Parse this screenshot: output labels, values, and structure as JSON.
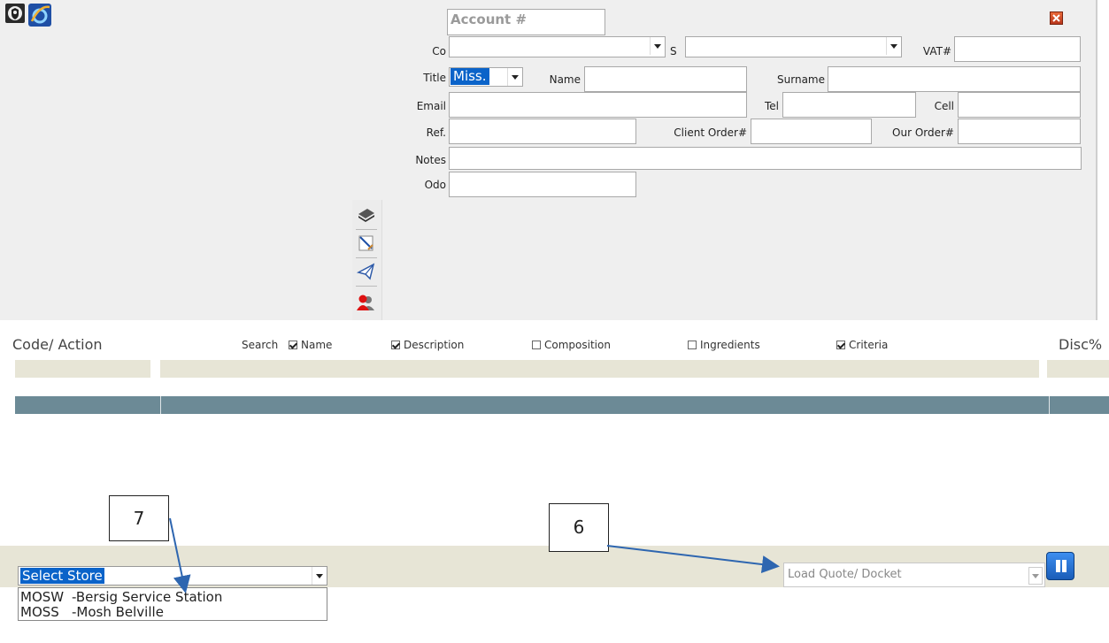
{
  "account": {
    "placeholder": "Account #"
  },
  "form": {
    "co_label": "Co",
    "s_label": "S",
    "vat_label": "VAT#",
    "title_label": "Title",
    "title_value": "Miss.",
    "name_label": "Name",
    "surname_label": "Surname",
    "email_label": "Email",
    "tel_label": "Tel",
    "cell_label": "Cell",
    "ref_label": "Ref.",
    "client_order_label": "Client Order#",
    "our_order_label": "Our Order#",
    "notes_label": "Notes",
    "odo_label": "Odo"
  },
  "search": {
    "code_action_label": "Code/ Action",
    "search_label": "Search",
    "options": [
      {
        "label": "Name",
        "checked": true
      },
      {
        "label": "Description",
        "checked": true
      },
      {
        "label": "Composition",
        "checked": false
      },
      {
        "label": "Ingredients",
        "checked": false
      },
      {
        "label": "Criteria",
        "checked": true
      }
    ],
    "disc_label": "Disc%"
  },
  "store": {
    "selected": "Select Store",
    "options": [
      {
        "code": "MOSW",
        "name": "-Bersig Service Station"
      },
      {
        "code": "MOSS",
        "name": "-Mosh Belville"
      }
    ]
  },
  "load_quote": {
    "placeholder": "Load Quote/ Docket"
  },
  "callouts": {
    "seven": "7",
    "six": "6"
  },
  "icons": [
    "shield-icon",
    "ie-icon",
    "close-icon",
    "book-icon",
    "edit-icon",
    "send-icon",
    "users-icon",
    "pause-icon"
  ],
  "colors": {
    "header_band": "#6c8a96",
    "beige_band": "#e7e5d6",
    "selection": "#0a63c9",
    "accent_blue": "#2e66b0"
  }
}
